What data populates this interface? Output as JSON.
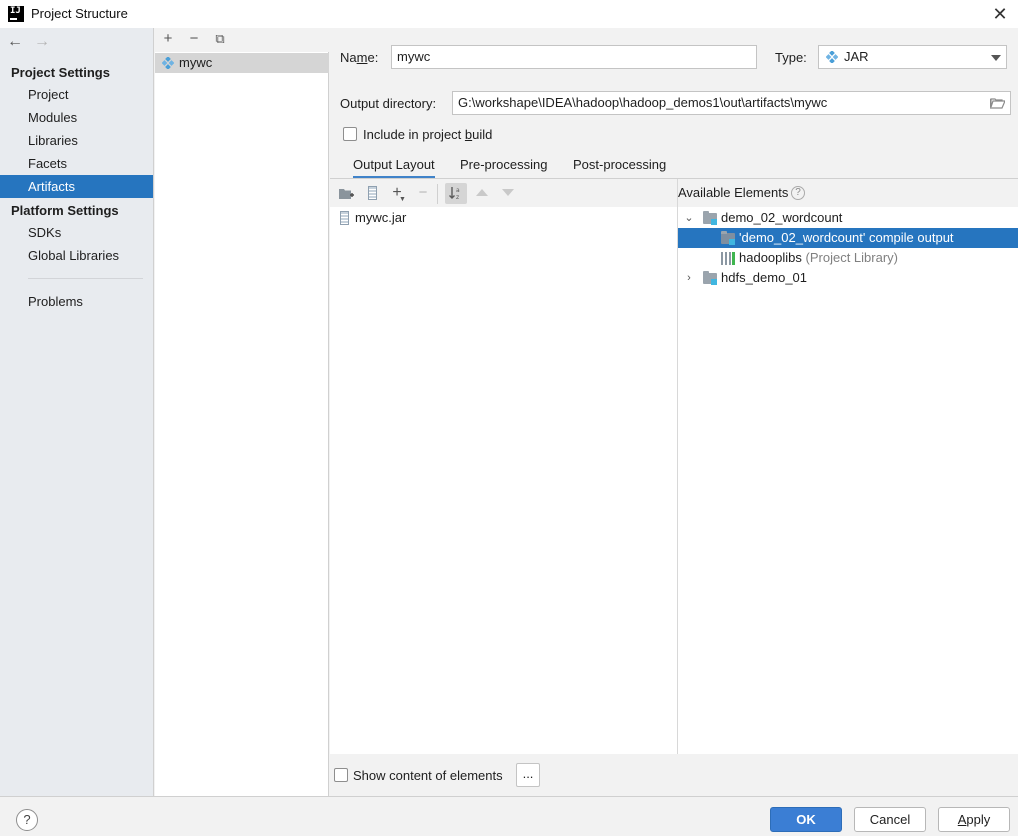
{
  "window": {
    "title": "Project Structure",
    "app_logo": "IJ"
  },
  "nav": {
    "back_icon": "←",
    "forward_icon": "→",
    "project_settings_header": "Project Settings",
    "project_items": [
      "Project",
      "Modules",
      "Libraries",
      "Facets",
      "Artifacts"
    ],
    "selected": "Artifacts",
    "platform_settings_header": "Platform Settings",
    "platform_items": [
      "SDKs",
      "Global Libraries"
    ],
    "problems": "Problems"
  },
  "artifacts": {
    "toolbar": {
      "add": "+",
      "remove": "−",
      "copy": "⧉"
    },
    "items": [
      "mywc"
    ]
  },
  "form": {
    "name_label_pre": "Na",
    "name_label_mnemonic": "m",
    "name_label_post": "e:",
    "name_value": "mywc",
    "type_label": "Type:",
    "type_value": "JAR",
    "output_dir_label": "Output directory:",
    "output_dir_value": "G:\\workshape\\IDEA\\hadoop\\hadoop_demos1\\out\\artifacts\\mywc",
    "include_build_pre": "Include in project ",
    "include_build_mnemonic": "b",
    "include_build_post": "uild",
    "include_build_checked": false
  },
  "tabs": [
    "Output Layout",
    "Pre-processing",
    "Post-processing"
  ],
  "active_tab": "Output Layout",
  "layout": {
    "tree": [
      "mywc.jar"
    ]
  },
  "available": {
    "header": "Available Elements",
    "help": "?",
    "tree": [
      {
        "label": "demo_02_wordcount",
        "expanded": true
      },
      {
        "label": "'demo_02_wordcount' compile output",
        "selected": true
      },
      {
        "label": "hadooplibs",
        "suffix": "(Project Library)"
      },
      {
        "label": "hdfs_demo_01",
        "expanded": false
      }
    ]
  },
  "show_content": {
    "label": "Show content of elements",
    "checked": false,
    "more": "..."
  },
  "footer": {
    "help": "?",
    "ok": "OK",
    "cancel": "Cancel",
    "apply_mnemonic": "A",
    "apply_rest": "pply"
  },
  "colors": {
    "selection": "#2675bf",
    "primary_button": "#3b7ed4",
    "artifact_icon": "#4a9fd8"
  }
}
